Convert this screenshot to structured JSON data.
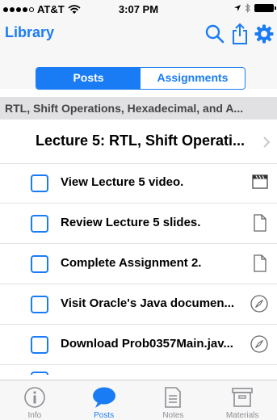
{
  "status": {
    "carrier": "AT&T",
    "time": "3:07 PM"
  },
  "navbar": {
    "title": "Library",
    "icons": [
      "search-icon",
      "share-icon",
      "gear-icon"
    ]
  },
  "segments": [
    {
      "label": "Posts",
      "active": true
    },
    {
      "label": "Assignments",
      "active": false
    }
  ],
  "section_header": "RTL, Shift Operations, Hexadecimal, and A...",
  "lecture": {
    "title": "Lecture 5: RTL, Shift Operati..."
  },
  "items": [
    {
      "label": "View Lecture 5 video.",
      "icon": "video-icon"
    },
    {
      "label": "Review Lecture 5 slides.",
      "icon": "document-icon"
    },
    {
      "label": "Complete Assignment 2.",
      "icon": "document-icon"
    },
    {
      "label": "Visit Oracle's Java documen...",
      "icon": "compass-icon"
    },
    {
      "label": "Download Prob0357Main.jav...",
      "icon": "compass-icon"
    }
  ],
  "tabbar": [
    {
      "label": "Info",
      "icon": "info-icon",
      "active": false
    },
    {
      "label": "Posts",
      "icon": "chat-bubble-icon",
      "active": true
    },
    {
      "label": "Notes",
      "icon": "notes-icon",
      "active": false
    },
    {
      "label": "Materials",
      "icon": "archive-icon",
      "active": false
    }
  ],
  "colors": {
    "accent": "#1a7cf4",
    "section_bg": "#e1e1e4",
    "bar_bg": "#f7f7f8",
    "inactive_tab": "#8e8e93"
  }
}
